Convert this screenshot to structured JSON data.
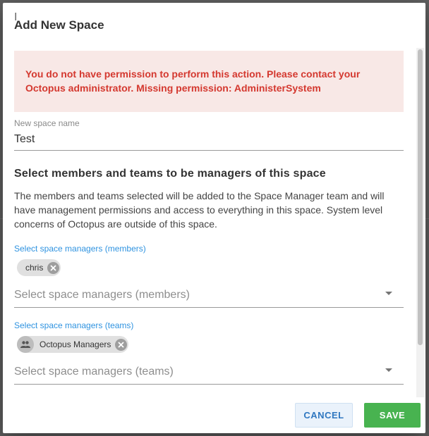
{
  "dialog": {
    "title": "Add New Space",
    "error_message": "You do not have permission to perform this action. Please contact your Octopus administrator. Missing permission: AdministerSystem",
    "space_name": {
      "label": "New space name",
      "value": "Test"
    },
    "managers_section": {
      "heading": "Select members and teams to be managers of this space",
      "description": "The members and teams selected will be added to the Space Manager team and will have management permissions and access to everything in this space. System level concerns of Octopus are outside of this space."
    },
    "members": {
      "label": "Select space managers (members)",
      "selected": [
        "chris"
      ],
      "placeholder": "Select space managers (members)"
    },
    "teams": {
      "label": "Select space managers (teams)",
      "selected": [
        "Octopus Managers"
      ],
      "placeholder": "Select space managers (teams)"
    },
    "buttons": {
      "cancel": "CANCEL",
      "save": "SAVE"
    }
  },
  "colors": {
    "error_text": "#d4382f",
    "error_background": "#f8e8e6",
    "label_blue": "#2f93e0",
    "save_green": "#48b350",
    "cancel_blue": "#2f77c0"
  },
  "icons": {
    "chip_remove": "close-circle-icon",
    "team_avatar": "people-icon",
    "dropdown": "caret-down-icon"
  }
}
